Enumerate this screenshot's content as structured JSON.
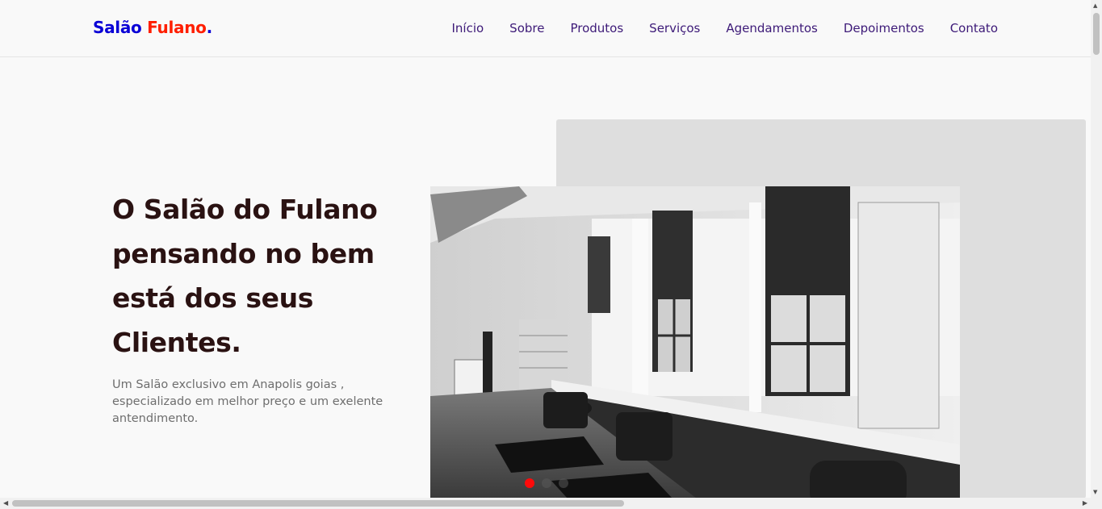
{
  "brand": {
    "part1": "Salão",
    "part2": "Fulano",
    "part3": ".",
    "colors": {
      "blue": "#0a00d6",
      "red": "#ff1e00"
    }
  },
  "nav": {
    "items": [
      "Início",
      "Sobre",
      "Produtos",
      "Serviços",
      "Agendamentos",
      "Depoimentos",
      "Contato"
    ]
  },
  "hero": {
    "headline": "O Salão do Fulano pensando no bem está dos seus Clientes.",
    "description": "Um Salão exclusivo em Anapolis goias , especializado em melhor preço e um exelente antendimento.",
    "image_alt": "salon-interior-photo",
    "carousel": {
      "slides": 3,
      "active": 1,
      "active_color": "#ff0a0a"
    }
  },
  "icons": {
    "scroll_up": "chevron-up-icon",
    "scroll_down": "chevron-down-icon",
    "scroll_left": "chevron-left-icon",
    "scroll_right": "chevron-right-icon"
  }
}
